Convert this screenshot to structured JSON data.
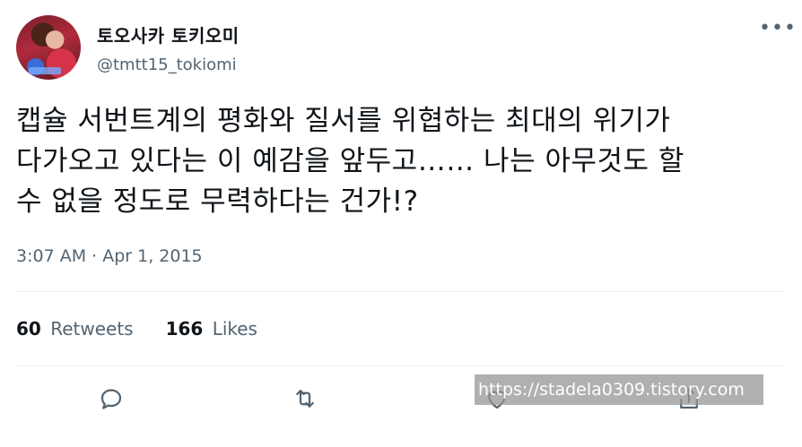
{
  "author": {
    "display_name": "토오사카 토키오미",
    "handle": "@tmtt15_tokiomi"
  },
  "more_icon": "more-horizontal-icon",
  "tweet": {
    "text": "캡슐 서번트계의 평화와 질서를 위협하는 최대의 위기가\n다가오고 있다는 이 예감을 앞두고…… 나는 아무것도 할\n수 없을 정도로 무력하다는 건가!?",
    "timestamp": "3:07 AM · Apr 1, 2015"
  },
  "stats": {
    "retweets_count": "60",
    "retweets_label": "Retweets",
    "likes_count": "166",
    "likes_label": "Likes"
  },
  "actions": [
    "reply-icon",
    "retweet-icon",
    "like-icon",
    "share-icon"
  ],
  "watermark": "https://stadela0309.tistory.com",
  "colors": {
    "text": "#0f1419",
    "secondary": "#536471",
    "divider": "#eff3f4"
  }
}
